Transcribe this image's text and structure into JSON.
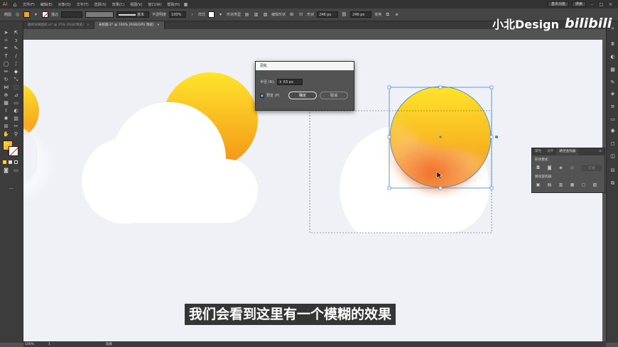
{
  "menubar": {
    "items": [
      "文件(F)",
      "编辑(E)",
      "对象(O)",
      "文字(T)",
      "选择(S)",
      "效果(C)",
      "视图(V)",
      "窗口(W)",
      "帮助(H)"
    ],
    "workspace": "基本功能",
    "search_placeholder": "搜索"
  },
  "controlbar": {
    "object_type": "椭圆",
    "fill_color": "#f7a21b",
    "stroke_label": "描边",
    "brush_label": "基本",
    "opacity_label": "不透明度",
    "opacity_value": "100%",
    "style_label": "样式",
    "shape_label": "形状",
    "width_value": "246 px",
    "height_value": "246 px",
    "transform_label": "变换",
    "edit_label": "编辑形状",
    "style_kind": "形状类型"
  },
  "tabs": [
    {
      "label": "最终效果图标.ai* @ 25% (RGB/预览)",
      "close": "×"
    },
    {
      "label": "未标题-2* @ 100% (RGB/GPU 预览)",
      "close": "×"
    }
  ],
  "feather_dialog": {
    "title": "羽化",
    "radius_label": "半径 (R):",
    "radius_value": "63 px",
    "preview_label": "预览 (P)",
    "preview_checked": true,
    "ok_label": "确定",
    "cancel_label": "取消"
  },
  "pathfinder_panel": {
    "tabs": [
      "属性",
      "对齐",
      "路径查找器"
    ],
    "shape_modes_label": "形状模式:",
    "expand_label": "扩展",
    "pathfinders_label": "路径查找器:"
  },
  "statusbar": {
    "zoom": "100%",
    "page": "1",
    "mode": "选择"
  },
  "subtitle": "我们会看到这里有一个模糊的效果",
  "watermark": {
    "name": "小北Design",
    "logo": "bilibili"
  },
  "colors": {
    "sun_top": "#ffe12a",
    "sun_bottom": "#f39a1c",
    "sun_blur": "#f06a24",
    "selection": "#3c7fd6",
    "canvas": "#f0f1f6"
  }
}
